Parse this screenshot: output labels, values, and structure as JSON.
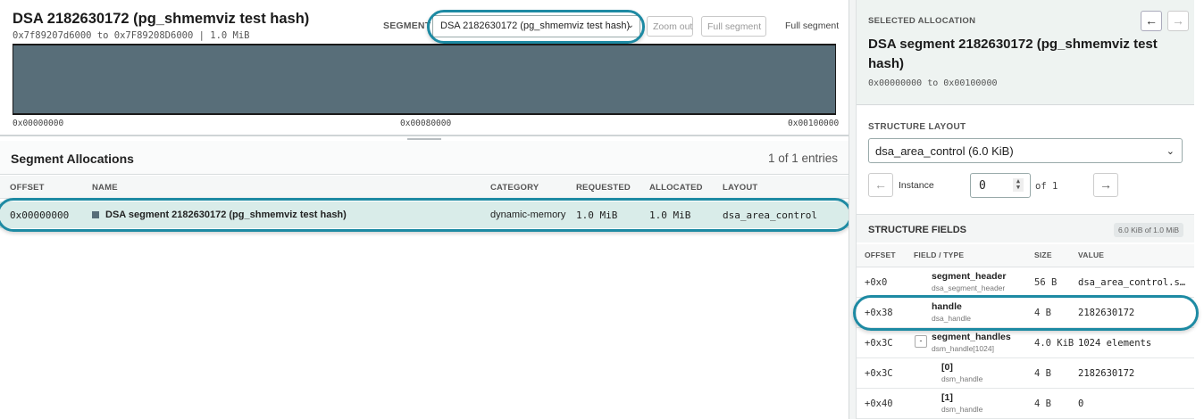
{
  "header": {
    "title": "DSA 2182630172 (pg_shmemviz test hash)",
    "range": "0x7f89207d6000 to 0x7F89208D6000 | 1.0 MiB",
    "segment_label": "SEGMENT",
    "segment_selected": "DSA 2182630172 (pg_shmemviz test hash)",
    "zoom_out": "Zoom out",
    "full_segment_button": "Full segment",
    "full_segment_link": "Full segment"
  },
  "memmap": {
    "color": "#586e79",
    "addr_start": "0x00000000",
    "addr_mid": "0x00080000",
    "addr_end": "0x00100000"
  },
  "allocations": {
    "title": "Segment Allocations",
    "count": "1 of 1 entries",
    "columns": [
      "OFFSET",
      "NAME",
      "CATEGORY",
      "REQUESTED",
      "ALLOCATED",
      "LAYOUT"
    ],
    "rows": [
      {
        "offset": "0x00000000",
        "name": "DSA segment 2182630172 (pg_shmemviz test hash)",
        "category": "dynamic-memory",
        "requested": "1.0 MiB",
        "allocated": "1.0 MiB",
        "layout": "dsa_area_control"
      }
    ]
  },
  "selected": {
    "label": "SELECTED ALLOCATION",
    "title": "DSA segment 2182630172 (pg_shmemviz test hash)",
    "range": "0x00000000 to 0x00100000",
    "back": "←",
    "forward": "→"
  },
  "structure": {
    "layout_label": "STRUCTURE LAYOUT",
    "layout_selected": "dsa_area_control (6.0 KiB)",
    "instance_label": "Instance",
    "instance_value": "0",
    "instance_of": "of 1",
    "fields_label": "STRUCTURE FIELDS",
    "fields_badge": "6.0 KiB of 1.0 MiB",
    "field_columns": [
      "OFFSET",
      "FIELD / TYPE",
      "SIZE",
      "VALUE"
    ],
    "fields": [
      {
        "offset": "+0x0",
        "name": "segment_header",
        "type": "dsa_segment_header",
        "size": "56 B",
        "value": "dsa_area_control.s…"
      },
      {
        "offset": "+0x38",
        "name": "handle",
        "type": "dsa_handle",
        "size": "4 B",
        "value": "2182630172"
      },
      {
        "offset": "+0x3C",
        "name": "segment_handles",
        "type": "dsm_handle[1024]",
        "size": "4.0 KiB",
        "value": "1024 elements",
        "toggle": "-"
      },
      {
        "offset": "+0x3C",
        "name": "[0]",
        "type": "dsm_handle",
        "size": "4 B",
        "value": "2182630172"
      },
      {
        "offset": "+0x40",
        "name": "[1]",
        "type": "dsm_handle",
        "size": "4 B",
        "value": "0"
      }
    ]
  },
  "highlight_color": "#1d8aa3"
}
